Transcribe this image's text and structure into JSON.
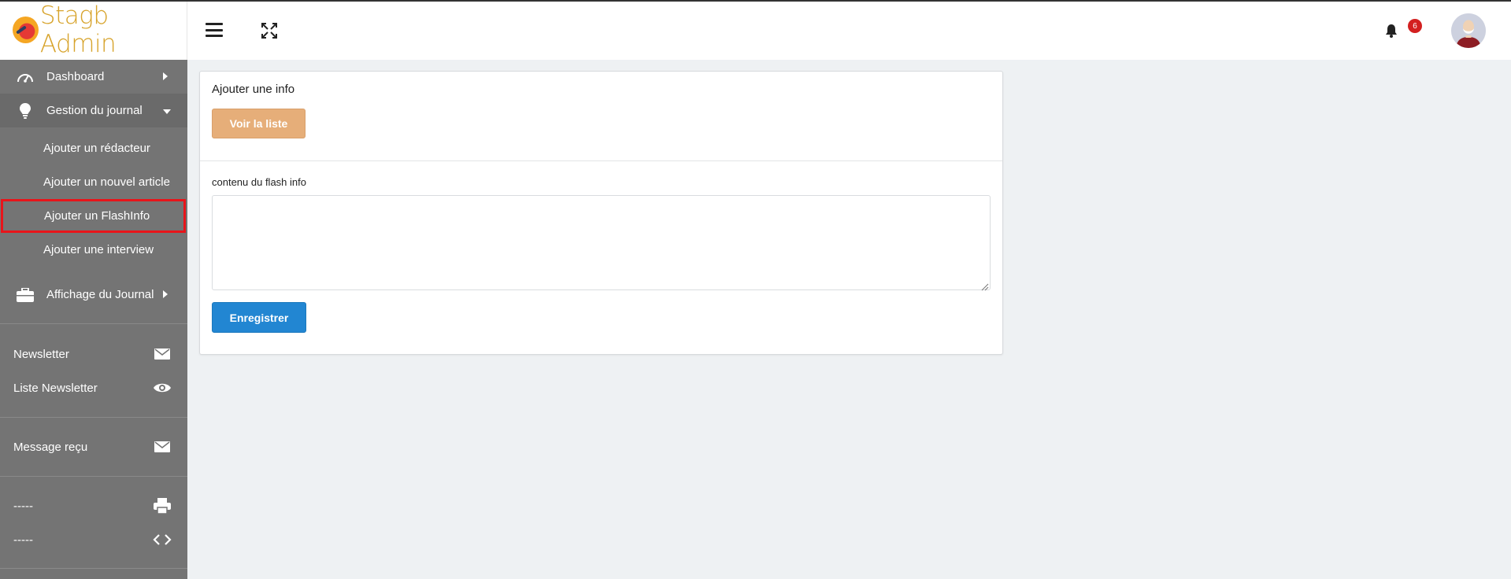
{
  "brand": {
    "name": "Stagb Admin",
    "logo_icon": "rocket-logo-icon"
  },
  "sidebar": {
    "menu": [
      {
        "label": "Dashboard",
        "icon": "speedometer-icon"
      },
      {
        "label": "Gestion du journal",
        "icon": "lightbulb-icon"
      },
      {
        "label": "Affichage du Journal",
        "icon": "briefcase-icon"
      }
    ],
    "submenu": [
      {
        "label": "Ajouter un rédacteur"
      },
      {
        "label": "Ajouter un nouvel article"
      },
      {
        "label": "Ajouter un FlashInfo",
        "active": true
      },
      {
        "label": "Ajouter une interview"
      }
    ],
    "extra": [
      {
        "label": "Newsletter",
        "icon": "envelope-icon"
      },
      {
        "label": "Liste Newsletter",
        "icon": "eye-icon"
      },
      {
        "label": "Message reçu",
        "icon": "envelope-icon"
      },
      {
        "label": "-----",
        "icon": "printer-icon"
      },
      {
        "label": "-----",
        "icon": "code-icon"
      }
    ]
  },
  "header": {
    "notifications_count": "6",
    "icons": [
      "hamburger-icon",
      "expand-icon",
      "bell-icon",
      "avatar"
    ]
  },
  "card": {
    "title": "Ajouter une info",
    "list_button": "Voir la liste",
    "field_label": "contenu du flash info",
    "textarea_value": "",
    "save_button": "Enregistrer"
  },
  "colors": {
    "sidebar_bg": "#747474",
    "brand_text": "#d7a32b",
    "active_outline": "#e8141a",
    "list_button": "#e6ae79",
    "save_button": "#2286d2",
    "badge": "#d32020"
  }
}
